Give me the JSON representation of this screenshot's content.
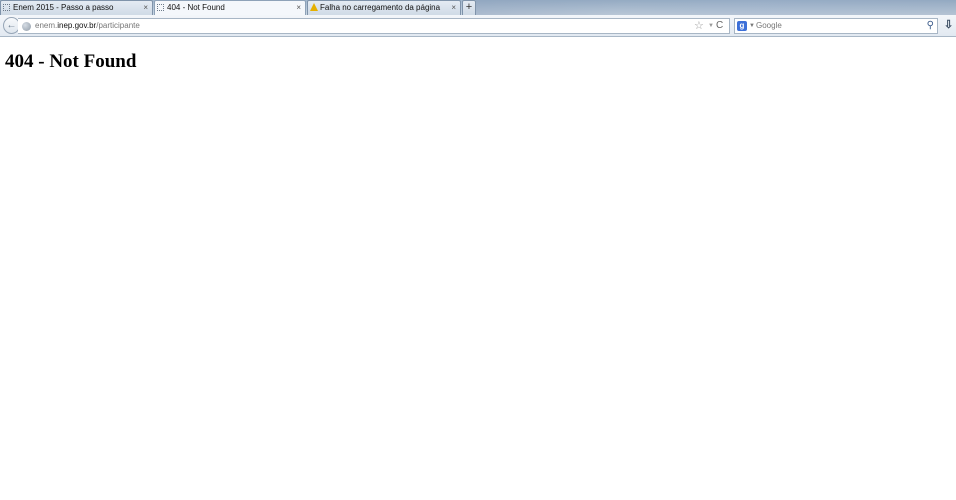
{
  "browser": {
    "tabs": [
      {
        "label": "Enem 2015 - Passo a passo",
        "icon": "blank-page-icon",
        "active": false
      },
      {
        "label": "404 - Not Found",
        "icon": "blank-page-icon",
        "active": true
      },
      {
        "label": "Falha no carregamento da página",
        "icon": "warning-icon",
        "active": false
      }
    ],
    "new_tab_symbol": "+",
    "close_symbol": "×",
    "url": {
      "prefix": "enem.",
      "host": "inep.gov.br",
      "path": "/participante"
    },
    "search": {
      "placeholder": "Google",
      "engine_icon": "g"
    },
    "icons": {
      "back": "←",
      "star": "☆",
      "dropdown": "▼",
      "reload": "C",
      "magnifier": "⚲",
      "download": "⇩"
    }
  },
  "page": {
    "heading": "404 - Not Found"
  }
}
